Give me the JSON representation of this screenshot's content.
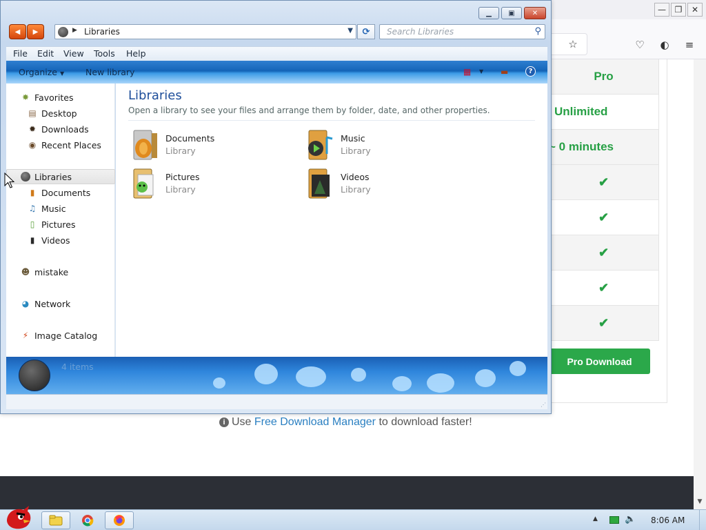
{
  "browser": {
    "pricing_rows": [
      "Pro",
      "Unlimited",
      "~ 0 minutes"
    ],
    "checkmark": "✔",
    "pro_download_label": "Pro Download",
    "promo": {
      "prefix": "Use ",
      "link_text": "Free Download Manager",
      "suffix": " to download faster!"
    }
  },
  "explorer": {
    "address": "Libraries",
    "search_placeholder": "Search Libraries",
    "menu": [
      "File",
      "Edit",
      "View",
      "Tools",
      "Help"
    ],
    "commands": {
      "organize": "Organize",
      "new_library": "New library"
    },
    "nav": {
      "favorites": "Favorites",
      "desktop": "Desktop",
      "downloads": "Downloads",
      "recent_places": "Recent Places",
      "libraries": "Libraries",
      "documents": "Documents",
      "music": "Music",
      "pictures": "Pictures",
      "videos": "Videos",
      "homegroup_user": "mistake",
      "network": "Network",
      "image_catalog": "Image Catalog"
    },
    "content": {
      "title": "Libraries",
      "subtitle": "Open a library to see your files and arrange them by folder, date, and other properties.",
      "libraries": [
        {
          "name": "Documents",
          "kind": "Library"
        },
        {
          "name": "Music",
          "kind": "Library"
        },
        {
          "name": "Pictures",
          "kind": "Library"
        },
        {
          "name": "Videos",
          "kind": "Library"
        }
      ]
    },
    "status": {
      "item_count": "4 items"
    }
  },
  "taskbar": {
    "clock": "8:06 AM"
  },
  "colors": {
    "accent_green": "#2ba84a",
    "explorer_blue": "#1e4e9a",
    "link_blue": "#2a7fc1"
  }
}
